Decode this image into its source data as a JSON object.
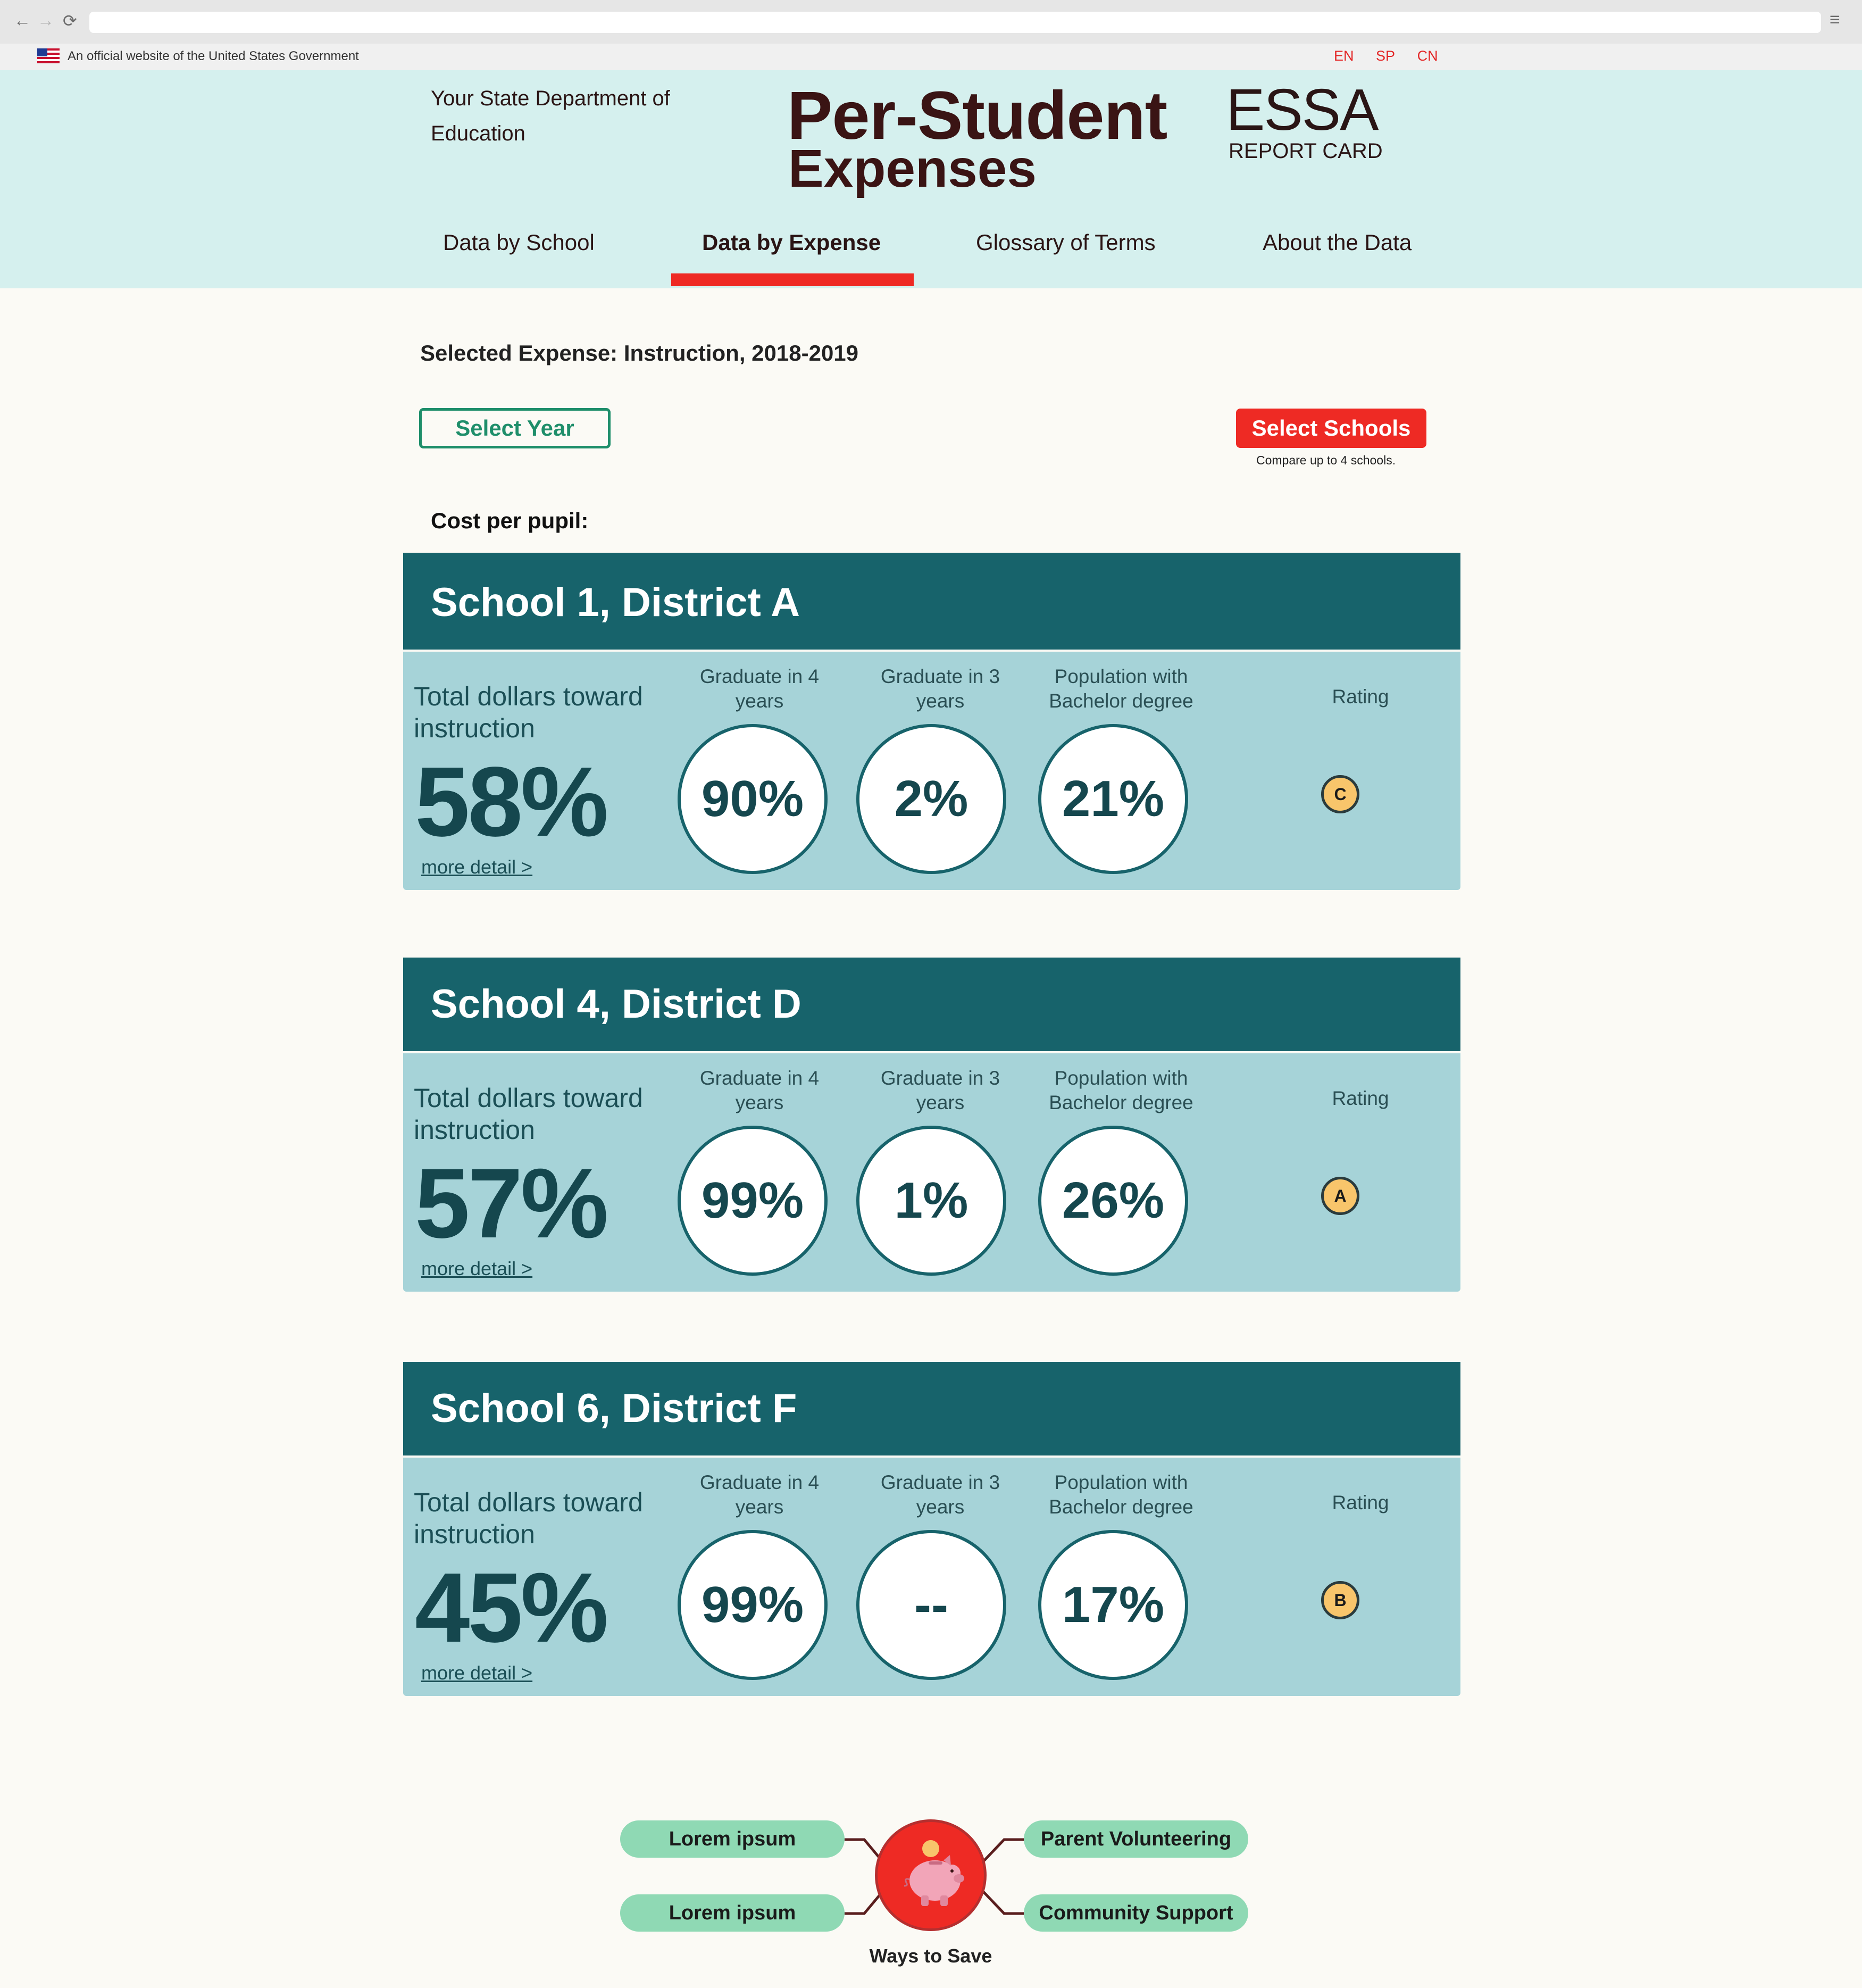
{
  "browser": {
    "back_icon": "←",
    "forward_icon": "→",
    "reload_icon": "⟳",
    "menu_icon": "≡"
  },
  "gov_banner": {
    "text": "An official website of the United States Government",
    "languages": [
      "EN",
      "SP",
      "CN"
    ]
  },
  "header": {
    "department": "Your State Department of Education",
    "title_line1": "Per-Student",
    "title_line2": "Expenses",
    "logo_main": "ESSA",
    "logo_sub": "REPORT CARD"
  },
  "nav": {
    "tabs": [
      {
        "label": "Data by School"
      },
      {
        "label": "Data by Expense",
        "active": true
      },
      {
        "label": "Glossary of Terms"
      },
      {
        "label": "About the Data"
      }
    ],
    "accent_color": "#ee2a24"
  },
  "controls": {
    "selected_expense": "Selected Expense: Instruction, 2018-2019",
    "select_year_label": "Select Year",
    "select_schools_label": "Select Schools",
    "compare_note": "Compare up to 4 schools.",
    "cost_label": "Cost per pupil:"
  },
  "labels": {
    "total_dollars": "Total dollars toward instruction",
    "grad4": "Graduate in 4 years",
    "grad3": "Graduate in 3 years",
    "bachelor": "Population with Bachelor degree",
    "rating": "Rating",
    "more_detail": "more detail >"
  },
  "schools": [
    {
      "name": "School 1, District A",
      "total_pct": "58%",
      "grad4": "90%",
      "grad3": "2%",
      "bachelor": "21%",
      "rating": "C"
    },
    {
      "name": "School 4, District D",
      "total_pct": "57%",
      "grad4": "99%",
      "grad3": "1%",
      "bachelor": "26%",
      "rating": "A"
    },
    {
      "name": "School 6, District F",
      "total_pct": "45%",
      "grad4": "99%",
      "grad3": "--",
      "bachelor": "17%",
      "rating": "B"
    }
  ],
  "ways_to_save": {
    "label": "Ways to Save",
    "left_items": [
      "Lorem ipsum",
      "Lorem ipsum"
    ],
    "right_items": [
      "Parent Volunteering",
      "Community Support"
    ],
    "icon": "piggy-bank-icon"
  }
}
